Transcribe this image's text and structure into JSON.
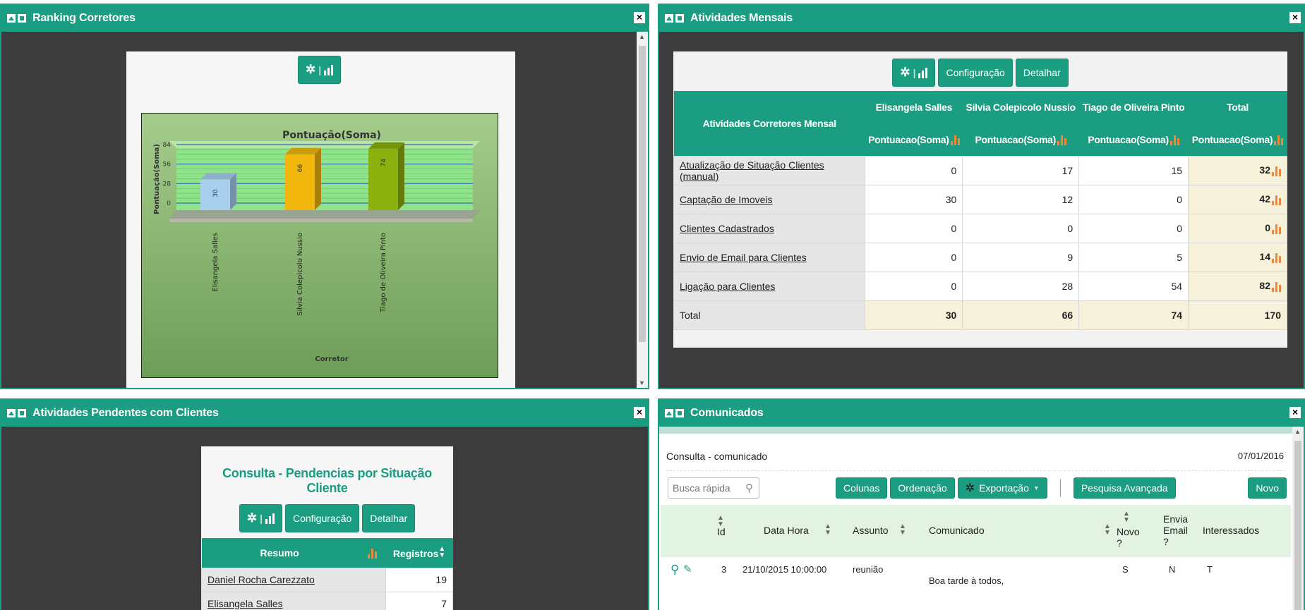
{
  "panels": {
    "ranking": {
      "title": "Ranking Corretores",
      "chart_btn_icon": "gear-bar-chart-icon"
    },
    "mensais": {
      "title": "Atividades Mensais",
      "config_label": "Configuração",
      "detail_label": "Detalhar",
      "corner_header": "Atividades Corretores Mensal",
      "columns": [
        "Elisangela Salles",
        "Silvia Colepicolo Nussio",
        "Tiago de Oliveira Pinto",
        "Total"
      ],
      "measure": "Pontuacao(Soma)",
      "rows": [
        {
          "label": "Atualização de Situação Clientes (manual)",
          "values": [
            "0",
            "17",
            "15",
            "32"
          ]
        },
        {
          "label": "Captação de Imoveis",
          "values": [
            "30",
            "12",
            "0",
            "42"
          ]
        },
        {
          "label": "Clientes Cadastrados",
          "values": [
            "0",
            "0",
            "0",
            "0"
          ]
        },
        {
          "label": "Envio de Email para Clientes",
          "values": [
            "0",
            "9",
            "5",
            "14"
          ]
        },
        {
          "label": "Ligação para Clientes",
          "values": [
            "0",
            "28",
            "54",
            "82"
          ]
        }
      ],
      "total_row": {
        "label": "Total",
        "values": [
          "30",
          "66",
          "74",
          "170"
        ]
      }
    },
    "pendentes": {
      "title": "Atividades Pendentes com Clientes",
      "card_title": "Consulta - Pendencias por Situação Cliente",
      "config_label": "Configuração",
      "detail_label": "Detalhar",
      "col_resumo": "Resumo",
      "col_registros": "Registros",
      "rows": [
        {
          "label": "Daniel Rocha Carezzato",
          "value": "19"
        },
        {
          "label": "Elisangela Salles",
          "value": "7"
        }
      ]
    },
    "comunicados": {
      "title": "Comunicados",
      "query_title": "Consulta - comunicado",
      "date": "07/01/2016",
      "search_placeholder": "Busca rápida",
      "btn_colunas": "Colunas",
      "btn_ordenacao": "Ordenação",
      "btn_exportacao": "Exportação",
      "btn_pesquisa": "Pesquisa Avançada",
      "btn_novo": "Novo",
      "headers": {
        "id": "Id",
        "data_hora": "Data Hora",
        "assunto": "Assunto",
        "comunicado": "Comunicado",
        "novo": "Novo ?",
        "envia_email": "Envia Email ?",
        "interessados": "Interessados"
      },
      "row": {
        "id": "3",
        "data_hora": "21/10/2015 10:00:00",
        "assunto": "reunião",
        "comunicado": "Boa tarde à todos,",
        "novo": "S",
        "envia_email": "N",
        "interessados": "T"
      }
    }
  },
  "chart_data": {
    "type": "bar",
    "title": "Pontuação(Soma)",
    "xlabel": "Corretor",
    "ylabel": "Pontuação(Soma)",
    "categories": [
      "Elisangela Salles",
      "Silvia Colepicolo Nussio",
      "Tiago de Oliveira Pinto"
    ],
    "values": [
      30,
      66,
      74
    ],
    "value_labels": [
      "30",
      "66",
      "74"
    ],
    "yticks": [
      "0",
      "28",
      "56",
      "84"
    ],
    "ylim": [
      0,
      84
    ],
    "colors": [
      "#a8cfee",
      "#f2b70d",
      "#8ab10e"
    ]
  }
}
